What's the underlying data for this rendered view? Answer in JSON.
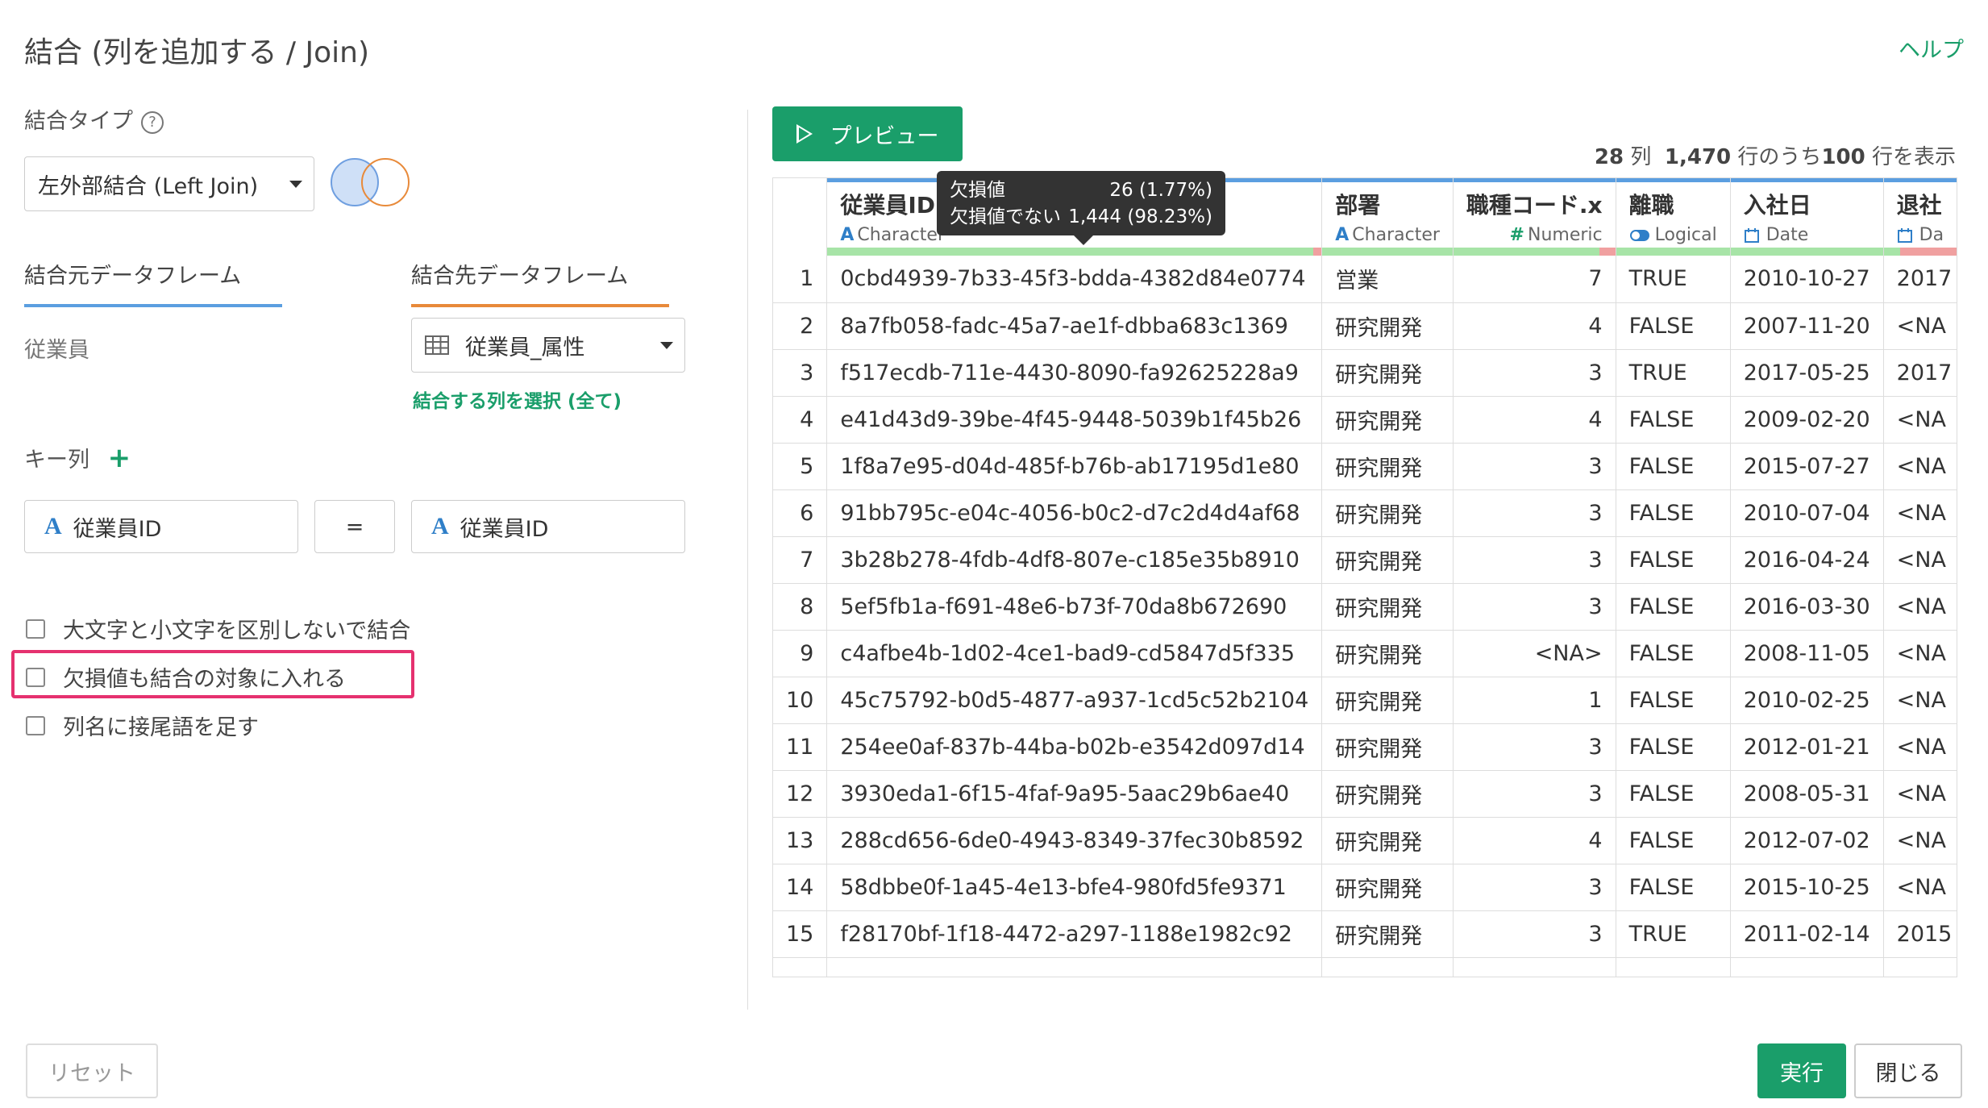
{
  "dialog": {
    "title": "結合 (列を追加する / Join)",
    "help_link": "ヘルプ"
  },
  "join_type": {
    "label": "結合タイプ",
    "help_icon": "question-circle-icon",
    "selected": "左外部結合 (Left Join)"
  },
  "source": {
    "tab_label": "結合元データフレーム",
    "tab_color": "#5b9ee0",
    "dataframe": "従業員"
  },
  "target": {
    "tab_label": "結合先データフレーム",
    "tab_color": "#e88a3a",
    "dataframe": "従業員_属性",
    "select_columns_link": "結合する列を選択 (全て)"
  },
  "keys": {
    "label": "キー列",
    "add_icon": "plus-icon",
    "left_column": "従業員ID",
    "operator": "=",
    "right_column": "従業員ID",
    "type_letter": "A"
  },
  "options": [
    {
      "label": "大文字と小文字を区別しないで結合",
      "checked": false
    },
    {
      "label": "欠損値も結合の対象に入れる",
      "checked": false
    },
    {
      "label": "列名に接尾語を足す",
      "checked": false
    }
  ],
  "preview": {
    "button_label": "プレビュー",
    "summary_cols": "28",
    "summary_cols_unit": "列",
    "summary_rows_total": "1,470",
    "summary_rows_mid": "行のうち",
    "summary_rows_shown": "100",
    "summary_rows_tail": "行を表示"
  },
  "tooltip": {
    "missing_label": "欠損値",
    "missing_value": "26 (1.77%)",
    "present_label": "欠損値でない",
    "present_value": "1,444 (98.23%)"
  },
  "table": {
    "columns": [
      {
        "name": "従業員ID",
        "type_icon": "A",
        "type": "Character",
        "missing_ratio": 0.02
      },
      {
        "name": "部署",
        "type_icon": "A",
        "type": "Character",
        "missing_ratio": 0
      },
      {
        "name": "職種コード.x",
        "type_icon": "#",
        "type": "Numeric",
        "missing_ratio": 0.12
      },
      {
        "name": "離職",
        "type_icon": "toggle-icon",
        "type": "Logical",
        "missing_ratio": 0
      },
      {
        "name": "入社日",
        "type_icon": "calendar-icon",
        "type": "Date",
        "missing_ratio": 0
      },
      {
        "name": "退社",
        "type_icon": "calendar-icon",
        "type": "Da",
        "missing_ratio": 0.85
      }
    ],
    "rows": [
      [
        "1",
        "0cbd4939-7b33-45f3-bdda-4382d84e0774",
        "営業",
        "7",
        "TRUE",
        "2010-10-27",
        "2017"
      ],
      [
        "2",
        "8a7fb058-fadc-45a7-ae1f-dbba683c1369",
        "研究開発",
        "4",
        "FALSE",
        "2007-11-20",
        "<NA"
      ],
      [
        "3",
        "f517ecdb-711e-4430-8090-fa92625228a9",
        "研究開発",
        "3",
        "TRUE",
        "2017-05-25",
        "2017"
      ],
      [
        "4",
        "e41d43d9-39be-4f45-9448-5039b1f45b26",
        "研究開発",
        "4",
        "FALSE",
        "2009-02-20",
        "<NA"
      ],
      [
        "5",
        "1f8a7e95-d04d-485f-b76b-ab17195d1e80",
        "研究開発",
        "3",
        "FALSE",
        "2015-07-27",
        "<NA"
      ],
      [
        "6",
        "91bb795c-e04c-4056-b0c2-d7c2d4d4af68",
        "研究開発",
        "3",
        "FALSE",
        "2010-07-04",
        "<NA"
      ],
      [
        "7",
        "3b28b278-4fdb-4df8-807e-c185e35b8910",
        "研究開発",
        "3",
        "FALSE",
        "2016-04-24",
        "<NA"
      ],
      [
        "8",
        "5ef5fb1a-f691-48e6-b73f-70da8b672690",
        "研究開発",
        "3",
        "FALSE",
        "2016-03-30",
        "<NA"
      ],
      [
        "9",
        "c4afbe4b-1d02-4ce1-bad9-cd5847d5f335",
        "研究開発",
        "<NA>",
        "FALSE",
        "2008-11-05",
        "<NA"
      ],
      [
        "10",
        "45c75792-b0d5-4877-a937-1cd5c52b2104",
        "研究開発",
        "1",
        "FALSE",
        "2010-02-25",
        "<NA"
      ],
      [
        "11",
        "254ee0af-837b-44ba-b02b-e3542d097d14",
        "研究開発",
        "3",
        "FALSE",
        "2012-01-21",
        "<NA"
      ],
      [
        "12",
        "3930eda1-6f15-4faf-9a95-5aac29b6ae40",
        "研究開発",
        "3",
        "FALSE",
        "2008-05-31",
        "<NA"
      ],
      [
        "13",
        "288cd656-6de0-4943-8349-37fec30b8592",
        "研究開発",
        "4",
        "FALSE",
        "2012-07-02",
        "<NA"
      ],
      [
        "14",
        "58dbbe0f-1a45-4e13-bfe4-980fd5fe9371",
        "研究開発",
        "3",
        "FALSE",
        "2015-10-25",
        "<NA"
      ],
      [
        "15",
        "f28170bf-1f18-4472-a297-1188e1982c92",
        "研究開発",
        "3",
        "TRUE",
        "2011-02-14",
        "2015"
      ]
    ]
  },
  "footer": {
    "reset_label": "リセット",
    "run_label": "実行",
    "close_label": "閉じる"
  }
}
